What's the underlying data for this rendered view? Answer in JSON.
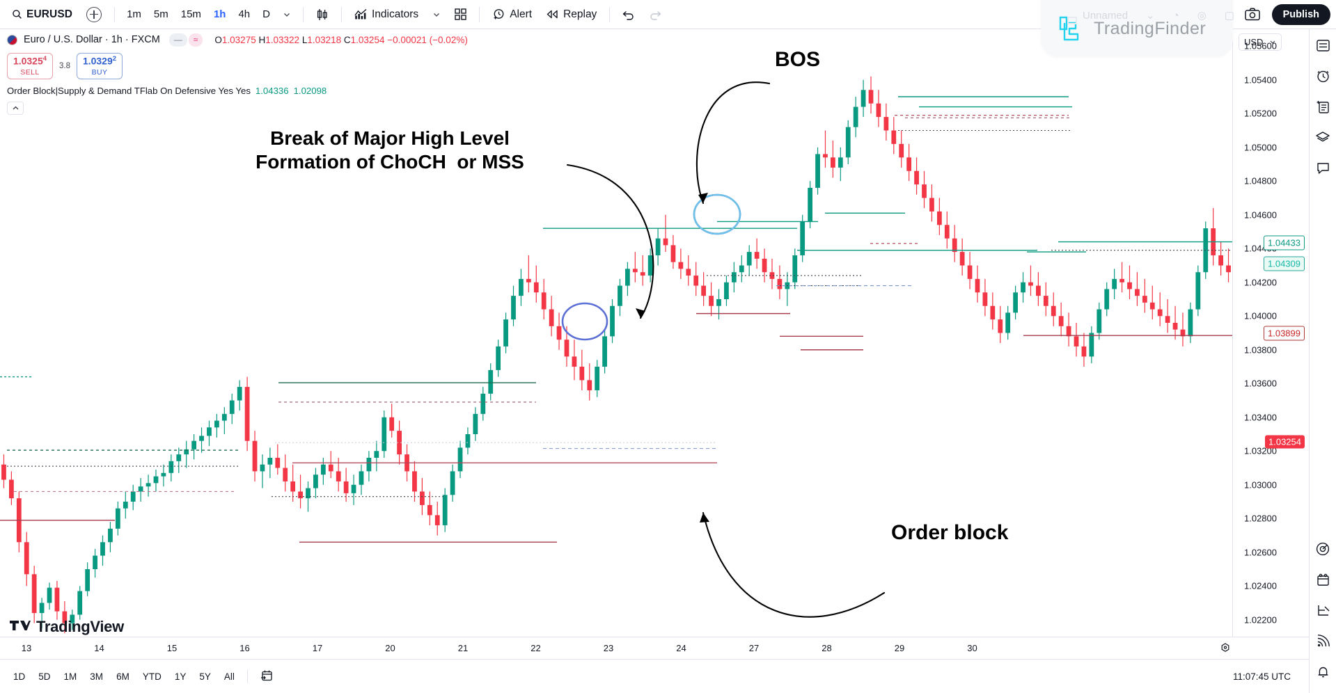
{
  "toolbar": {
    "search_icon": "search-icon",
    "symbol": "EURUSD",
    "add_symbol_icon": "plus-circle-icon",
    "timeframes": [
      {
        "label": "1m",
        "active": false
      },
      {
        "label": "5m",
        "active": false
      },
      {
        "label": "15m",
        "active": false
      },
      {
        "label": "1h",
        "active": true
      },
      {
        "label": "4h",
        "active": false
      },
      {
        "label": "D",
        "active": false
      }
    ],
    "timeframe_more_icon": "chevron-down-icon",
    "chart_type_icon": "candlestick-icon",
    "indicators_label": "Indicators",
    "indicators_icon": "indicators-chart-icon",
    "indicators_chevron_icon": "chevron-down-icon",
    "templates_icon": "grid-four-icon",
    "alert_label": "Alert",
    "alert_icon": "alarm-clock-plus-icon",
    "replay_label": "Replay",
    "replay_icon": "replay-rewind-icon",
    "undo_icon": "undo-arrow-icon",
    "redo_icon": "redo-arrow-icon",
    "snapshot_icon": "camera-icon",
    "publish_label": "Publish"
  },
  "overlay_watermark": {
    "brand": "TradingFinder",
    "logo_icon": "tradingfinder-logo-icon",
    "ghost_layout_name": "Unnamed",
    "ghost_chevron_icon": "chevron-down-icon",
    "ghost_rocket_icon": "rocket-icon",
    "ghost_at_icon": "at-sign-icon",
    "ghost_square_icon": "square-icon"
  },
  "legend": {
    "flag_icon": "eu-us-flag-icon",
    "title": "Euro / U.S. Dollar · 1h · FXCM",
    "badge_minus": "—",
    "badge_wave": "≈",
    "ohlc": {
      "o_label": "O",
      "o_value": "1.03275",
      "h_label": "H",
      "h_value": "1.03322",
      "l_label": "L",
      "l_value": "1.03218",
      "c_label": "C",
      "c_value": "1.03254",
      "change": "−0.00021 (−0.02%)"
    },
    "sell": {
      "price": "1.0325",
      "price_sup": "4",
      "label": "SELL"
    },
    "spread": "3.8",
    "buy": {
      "price": "1.0329",
      "price_sup": "2",
      "label": "BUY"
    },
    "indicator_line": "Order Block|Supply & Demand TFlab On Defensive Yes Yes",
    "indicator_v1": "1.04336",
    "indicator_v2": "1.02098",
    "collapse_icon": "chevron-up-icon"
  },
  "price_axis": {
    "currency": "USD",
    "currency_chevron_icon": "chevron-down-icon",
    "ticks": [
      "1.05600",
      "1.05400",
      "1.05200",
      "1.05000",
      "1.04800",
      "1.04600",
      "1.04400",
      "1.04200",
      "1.04000",
      "1.03800",
      "1.03600",
      "1.03400",
      "1.03200",
      "1.03000",
      "1.02800",
      "1.02600",
      "1.02400",
      "1.02200"
    ],
    "badges": [
      {
        "value": "1.04433",
        "kind": "greenline"
      },
      {
        "value": "1.04309",
        "kind": "tealline"
      },
      {
        "value": "1.03899",
        "kind": "darkred"
      },
      {
        "value": "1.03254",
        "kind": "red"
      }
    ]
  },
  "time_axis": {
    "ticks": [
      "13",
      "14",
      "15",
      "16",
      "17",
      "20",
      "21",
      "22",
      "23",
      "24",
      "27",
      "28",
      "29",
      "30"
    ],
    "settings_icon": "gear-hex-icon"
  },
  "bottom_bar": {
    "ranges": [
      "1D",
      "5D",
      "1M",
      "3M",
      "6M",
      "YTD",
      "1Y",
      "5Y",
      "All"
    ],
    "calendar_icon": "calendar-arrow-icon",
    "clock": "11:07:45 UTC"
  },
  "right_sidebar": {
    "items": [
      {
        "icon": "watchlist-icon"
      },
      {
        "icon": "alerts-clock-icon"
      },
      {
        "icon": "data-window-icon"
      },
      {
        "icon": "layers-icon"
      },
      {
        "icon": "chat-bubble-icon"
      }
    ],
    "bottom_items": [
      {
        "icon": "ideas-target-icon"
      },
      {
        "icon": "calendar-icon"
      },
      {
        "icon": "strategy-icon"
      },
      {
        "icon": "broadcast-icon"
      },
      {
        "icon": "bell-icon"
      }
    ]
  },
  "annotations": [
    {
      "id": "choch",
      "text": "Break of Major High Level\nFormation of ChoCH  or MSS"
    },
    {
      "id": "bos",
      "text": "BOS"
    },
    {
      "id": "ob",
      "text": "Order block"
    }
  ],
  "watermark": {
    "tradingview_label": "TradingView",
    "logo_icon": "tradingview-logo-icon"
  },
  "colors": {
    "bull": "#089981",
    "bear": "#f23645",
    "accent": "#2962ff",
    "grid": "#e0e3eb",
    "brand_cyan": "#22d3ee"
  },
  "chart_data": {
    "type": "candlestick",
    "symbol": "EURUSD",
    "timeframe": "1h",
    "exchange": "FXCM",
    "ylim": [
      1.021,
      1.057
    ],
    "ylabel": "USD",
    "xlabel": "",
    "grid": false,
    "last_price": 1.03254,
    "x_tick_labels": [
      "13",
      "14",
      "15",
      "16",
      "17",
      "20",
      "21",
      "22",
      "23",
      "24",
      "27",
      "28",
      "29",
      "30"
    ],
    "y_tick_labels": [
      "1.05600",
      "1.05400",
      "1.05200",
      "1.05000",
      "1.04800",
      "1.04600",
      "1.04400",
      "1.04200",
      "1.04000",
      "1.03800",
      "1.03600",
      "1.03400",
      "1.03200",
      "1.03000",
      "1.02800",
      "1.02600",
      "1.02400",
      "1.02200"
    ],
    "candles": [
      [
        1.0312,
        1.0318,
        1.0298,
        1.0303
      ],
      [
        1.0303,
        1.0308,
        1.0288,
        1.0292
      ],
      [
        1.0292,
        1.0296,
        1.026,
        1.0266
      ],
      [
        1.0266,
        1.0272,
        1.024,
        1.0247
      ],
      [
        1.0247,
        1.0252,
        1.0218,
        1.0224
      ],
      [
        1.0224,
        1.0233,
        1.0215,
        1.023
      ],
      [
        1.023,
        1.0242,
        1.0226,
        1.0239
      ],
      [
        1.0239,
        1.0243,
        1.022,
        1.0225
      ],
      [
        1.0225,
        1.0231,
        1.0212,
        1.0218
      ],
      [
        1.0218,
        1.0226,
        1.0214,
        1.0223
      ],
      [
        1.0223,
        1.024,
        1.022,
        1.0237
      ],
      [
        1.0237,
        1.0254,
        1.0234,
        1.025
      ],
      [
        1.025,
        1.0262,
        1.0245,
        1.0258
      ],
      [
        1.0258,
        1.027,
        1.0252,
        1.0266
      ],
      [
        1.0266,
        1.0278,
        1.026,
        1.0274
      ],
      [
        1.0274,
        1.029,
        1.027,
        1.0286
      ],
      [
        1.0286,
        1.0296,
        1.028,
        1.029
      ],
      [
        1.029,
        1.03,
        1.0285,
        1.0296
      ],
      [
        1.0296,
        1.0304,
        1.029,
        1.0299
      ],
      [
        1.0299,
        1.0306,
        1.0293,
        1.0301
      ],
      [
        1.0301,
        1.0309,
        1.0296,
        1.0305
      ],
      [
        1.0305,
        1.0312,
        1.0299,
        1.0307
      ],
      [
        1.0307,
        1.0318,
        1.0302,
        1.0314
      ],
      [
        1.0314,
        1.0322,
        1.0307,
        1.0318
      ],
      [
        1.0318,
        1.0326,
        1.031,
        1.0321
      ],
      [
        1.0321,
        1.033,
        1.0315,
        1.0326
      ],
      [
        1.0326,
        1.0334,
        1.0319,
        1.0329
      ],
      [
        1.0329,
        1.0338,
        1.0323,
        1.0334
      ],
      [
        1.0334,
        1.0342,
        1.0328,
        1.0338
      ],
      [
        1.0338,
        1.0346,
        1.033,
        1.0342
      ],
      [
        1.0342,
        1.0354,
        1.0336,
        1.035
      ],
      [
        1.035,
        1.0362,
        1.0344,
        1.0358
      ],
      [
        1.0358,
        1.0364,
        1.032,
        1.0326
      ],
      [
        1.0326,
        1.0332,
        1.0302,
        1.0308
      ],
      [
        1.0308,
        1.0318,
        1.0298,
        1.0312
      ],
      [
        1.0312,
        1.0322,
        1.0304,
        1.0316
      ],
      [
        1.0316,
        1.0324,
        1.0306,
        1.031
      ],
      [
        1.031,
        1.0318,
        1.0296,
        1.0302
      ],
      [
        1.0302,
        1.0312,
        1.029,
        1.0296
      ],
      [
        1.0296,
        1.0306,
        1.0286,
        1.0292
      ],
      [
        1.0292,
        1.0302,
        1.0284,
        1.0298
      ],
      [
        1.0298,
        1.031,
        1.0292,
        1.0306
      ],
      [
        1.0306,
        1.0316,
        1.03,
        1.0312
      ],
      [
        1.0312,
        1.032,
        1.0304,
        1.0308
      ],
      [
        1.0308,
        1.0316,
        1.0296,
        1.0302
      ],
      [
        1.0302,
        1.031,
        1.029,
        1.0295
      ],
      [
        1.0295,
        1.0306,
        1.0288,
        1.03
      ],
      [
        1.03,
        1.0312,
        1.0294,
        1.0308
      ],
      [
        1.0308,
        1.032,
        1.0302,
        1.0316
      ],
      [
        1.0316,
        1.0326,
        1.0308,
        1.032
      ],
      [
        1.032,
        1.0344,
        1.0316,
        1.034
      ],
      [
        1.034,
        1.0348,
        1.0328,
        1.0332
      ],
      [
        1.0332,
        1.0338,
        1.0312,
        1.0318
      ],
      [
        1.0318,
        1.0324,
        1.0302,
        1.0308
      ],
      [
        1.0308,
        1.0314,
        1.029,
        1.0296
      ],
      [
        1.0296,
        1.0304,
        1.0282,
        1.0288
      ],
      [
        1.0288,
        1.0296,
        1.0276,
        1.0282
      ],
      [
        1.0282,
        1.029,
        1.027,
        1.0276
      ],
      [
        1.0276,
        1.0298,
        1.0272,
        1.0294
      ],
      [
        1.0294,
        1.0312,
        1.029,
        1.0308
      ],
      [
        1.0308,
        1.0326,
        1.0304,
        1.0322
      ],
      [
        1.0322,
        1.0334,
        1.0318,
        1.033
      ],
      [
        1.033,
        1.0346,
        1.0326,
        1.0342
      ],
      [
        1.0342,
        1.0358,
        1.0338,
        1.0354
      ],
      [
        1.0354,
        1.0372,
        1.035,
        1.0368
      ],
      [
        1.0368,
        1.0386,
        1.0364,
        1.0382
      ],
      [
        1.0382,
        1.0402,
        1.0378,
        1.0398
      ],
      [
        1.0398,
        1.0418,
        1.0394,
        1.0412
      ],
      [
        1.0412,
        1.0428,
        1.0406,
        1.0422
      ],
      [
        1.0422,
        1.0436,
        1.0414,
        1.042
      ],
      [
        1.042,
        1.043,
        1.0408,
        1.0414
      ],
      [
        1.0414,
        1.0422,
        1.0398,
        1.0404
      ],
      [
        1.0404,
        1.0412,
        1.0388,
        1.0394
      ],
      [
        1.0394,
        1.0402,
        1.038,
        1.0386
      ],
      [
        1.0386,
        1.0394,
        1.037,
        1.0376
      ],
      [
        1.0376,
        1.0386,
        1.0362,
        1.037
      ],
      [
        1.037,
        1.038,
        1.0356,
        1.0362
      ],
      [
        1.0362,
        1.0372,
        1.035,
        1.0356
      ],
      [
        1.0356,
        1.0374,
        1.0352,
        1.037
      ],
      [
        1.037,
        1.0392,
        1.0366,
        1.0388
      ],
      [
        1.0388,
        1.041,
        1.0384,
        1.0406
      ],
      [
        1.0406,
        1.0422,
        1.04,
        1.0418
      ],
      [
        1.0418,
        1.0432,
        1.0412,
        1.0428
      ],
      [
        1.0428,
        1.0438,
        1.042,
        1.0426
      ],
      [
        1.0426,
        1.0436,
        1.0418,
        1.0424
      ],
      [
        1.0424,
        1.044,
        1.042,
        1.0436
      ],
      [
        1.0436,
        1.0452,
        1.043,
        1.0446
      ],
      [
        1.0446,
        1.046,
        1.0438,
        1.0442
      ],
      [
        1.0442,
        1.0448,
        1.0428,
        1.0432
      ],
      [
        1.0432,
        1.044,
        1.0422,
        1.0428
      ],
      [
        1.0428,
        1.0436,
        1.0418,
        1.0424
      ],
      [
        1.0424,
        1.0432,
        1.0412,
        1.0418
      ],
      [
        1.0418,
        1.0426,
        1.0406,
        1.0412
      ],
      [
        1.0412,
        1.042,
        1.04,
        1.0406
      ],
      [
        1.0406,
        1.0416,
        1.0398,
        1.041
      ],
      [
        1.041,
        1.0424,
        1.0406,
        1.042
      ],
      [
        1.042,
        1.0432,
        1.0414,
        1.0426
      ],
      [
        1.0426,
        1.0436,
        1.042,
        1.043
      ],
      [
        1.043,
        1.0442,
        1.0424,
        1.0438
      ],
      [
        1.0438,
        1.0446,
        1.0428,
        1.0434
      ],
      [
        1.0434,
        1.044,
        1.042,
        1.0426
      ],
      [
        1.0426,
        1.0434,
        1.0416,
        1.0422
      ],
      [
        1.0422,
        1.043,
        1.041,
        1.0416
      ],
      [
        1.0416,
        1.0426,
        1.0406,
        1.042
      ],
      [
        1.042,
        1.044,
        1.0416,
        1.0436
      ],
      [
        1.0436,
        1.046,
        1.0432,
        1.0456
      ],
      [
        1.0456,
        1.048,
        1.0452,
        1.0476
      ],
      [
        1.0476,
        1.05,
        1.0472,
        1.0496
      ],
      [
        1.0496,
        1.051,
        1.0488,
        1.0494
      ],
      [
        1.0494,
        1.0504,
        1.0482,
        1.0488
      ],
      [
        1.0488,
        1.05,
        1.048,
        1.0494
      ],
      [
        1.0494,
        1.0516,
        1.049,
        1.0512
      ],
      [
        1.0512,
        1.053,
        1.0506,
        1.0524
      ],
      [
        1.0524,
        1.054,
        1.0518,
        1.0534
      ],
      [
        1.0534,
        1.0542,
        1.052,
        1.0526
      ],
      [
        1.0526,
        1.0534,
        1.0512,
        1.0518
      ],
      [
        1.0518,
        1.0526,
        1.0504,
        1.051
      ],
      [
        1.051,
        1.0518,
        1.0496,
        1.0502
      ],
      [
        1.0502,
        1.051,
        1.0488,
        1.0494
      ],
      [
        1.0494,
        1.0502,
        1.048,
        1.0486
      ],
      [
        1.0486,
        1.0494,
        1.0472,
        1.0478
      ],
      [
        1.0478,
        1.0486,
        1.0464,
        1.047
      ],
      [
        1.047,
        1.0478,
        1.0456,
        1.0462
      ],
      [
        1.0462,
        1.047,
        1.0448,
        1.0454
      ],
      [
        1.0454,
        1.0462,
        1.044,
        1.0446
      ],
      [
        1.0446,
        1.0454,
        1.0432,
        1.0438
      ],
      [
        1.0438,
        1.0446,
        1.0424,
        1.043
      ],
      [
        1.043,
        1.0438,
        1.0416,
        1.0422
      ],
      [
        1.0422,
        1.043,
        1.0408,
        1.0414
      ],
      [
        1.0414,
        1.0422,
        1.04,
        1.0406
      ],
      [
        1.0406,
        1.0414,
        1.0392,
        1.0398
      ],
      [
        1.0398,
        1.0406,
        1.0384,
        1.039
      ],
      [
        1.039,
        1.0406,
        1.0386,
        1.0402
      ],
      [
        1.0402,
        1.0418,
        1.0398,
        1.0414
      ],
      [
        1.0414,
        1.0426,
        1.0408,
        1.042
      ],
      [
        1.042,
        1.043,
        1.0412,
        1.0418
      ],
      [
        1.0418,
        1.0426,
        1.0406,
        1.0412
      ],
      [
        1.0412,
        1.042,
        1.04,
        1.0406
      ],
      [
        1.0406,
        1.0414,
        1.0394,
        1.04
      ],
      [
        1.04,
        1.0408,
        1.0388,
        1.0394
      ],
      [
        1.0394,
        1.0402,
        1.0382,
        1.0388
      ],
      [
        1.0388,
        1.0396,
        1.0376,
        1.0382
      ],
      [
        1.0382,
        1.039,
        1.037,
        1.0376
      ],
      [
        1.0376,
        1.0394,
        1.0372,
        1.039
      ],
      [
        1.039,
        1.0408,
        1.0386,
        1.0404
      ],
      [
        1.0404,
        1.042,
        1.04,
        1.0416
      ],
      [
        1.0416,
        1.0428,
        1.041,
        1.0422
      ],
      [
        1.0422,
        1.0432,
        1.0414,
        1.042
      ],
      [
        1.042,
        1.043,
        1.041,
        1.0416
      ],
      [
        1.0416,
        1.0426,
        1.0406,
        1.0412
      ],
      [
        1.0412,
        1.0422,
        1.0402,
        1.0408
      ],
      [
        1.0408,
        1.0418,
        1.0398,
        1.0404
      ],
      [
        1.0404,
        1.0414,
        1.0394,
        1.04
      ],
      [
        1.04,
        1.041,
        1.039,
        1.0396
      ],
      [
        1.0396,
        1.0406,
        1.0386,
        1.0392
      ],
      [
        1.0392,
        1.0402,
        1.0382,
        1.0388
      ],
      [
        1.0388,
        1.0408,
        1.0384,
        1.0404
      ],
      [
        1.0404,
        1.043,
        1.04,
        1.0426
      ],
      [
        1.0426,
        1.0456,
        1.0422,
        1.0452
      ],
      [
        1.0452,
        1.0464,
        1.043,
        1.0436
      ],
      [
        1.0436,
        1.0444,
        1.0424,
        1.043
      ],
      [
        1.043,
        1.044,
        1.042,
        1.0426
      ]
    ],
    "annotations": [
      {
        "label": "Break of Major High Level / Formation of ChoCH or MSS",
        "type": "circle-marker"
      },
      {
        "label": "BOS",
        "type": "circle-marker"
      },
      {
        "label": "Order block",
        "type": "zone-marker"
      }
    ]
  }
}
